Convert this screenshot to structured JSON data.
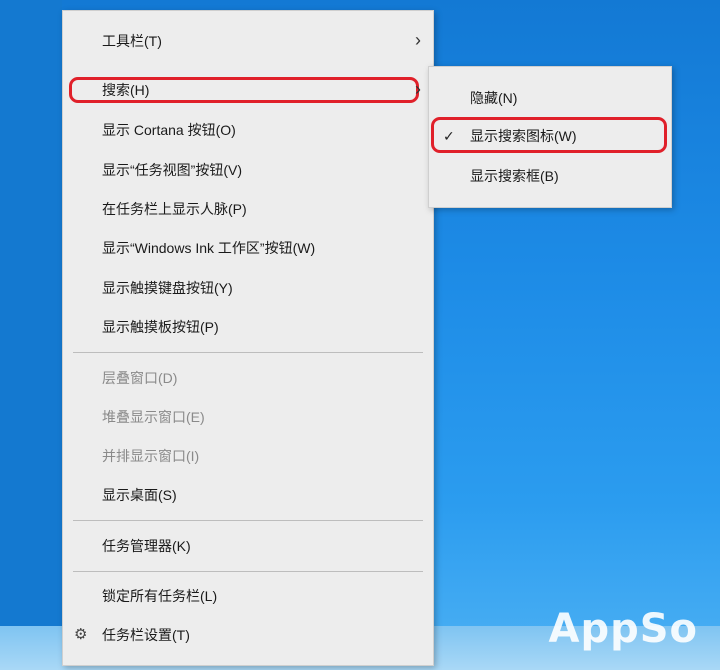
{
  "context_menu": {
    "items": [
      {
        "label": "工具栏(T)",
        "has_submenu": true,
        "disabled": false
      },
      {
        "label": "搜索(H)",
        "has_submenu": true,
        "disabled": false,
        "highlighted": true
      },
      {
        "label": "显示 Cortana 按钮(O)",
        "disabled": false
      },
      {
        "label": "显示“任务视图”按钮(V)",
        "disabled": false
      },
      {
        "label": "在任务栏上显示人脉(P)",
        "disabled": false
      },
      {
        "label": "显示“Windows Ink 工作区”按钮(W)",
        "disabled": false
      },
      {
        "label": "显示触摸键盘按钮(Y)",
        "disabled": false
      },
      {
        "label": "显示触摸板按钮(P)",
        "disabled": false
      },
      {
        "label": "层叠窗口(D)",
        "disabled": true
      },
      {
        "label": "堆叠显示窗口(E)",
        "disabled": true
      },
      {
        "label": "并排显示窗口(I)",
        "disabled": true
      },
      {
        "label": "显示桌面(S)",
        "disabled": false
      },
      {
        "label": "任务管理器(K)",
        "disabled": false
      },
      {
        "label": "锁定所有任务栏(L)",
        "disabled": false
      },
      {
        "label": "任务栏设置(T)",
        "disabled": false,
        "icon": "gear-icon"
      }
    ],
    "arrow_glyph": "›",
    "gear_glyph": "⚙"
  },
  "search_submenu": {
    "items": [
      {
        "label": "隐藏(N)",
        "checked": false
      },
      {
        "label": "显示搜索图标(W)",
        "checked": true,
        "highlighted": true
      },
      {
        "label": "显示搜索框(B)",
        "checked": false
      }
    ],
    "check_glyph": "✓"
  },
  "watermark": "AppSo",
  "colors": {
    "desktop": "#1d8be6",
    "menu_bg": "#ededed",
    "highlight_border": "#e0202a",
    "disabled_text": "#8a8a8a"
  }
}
